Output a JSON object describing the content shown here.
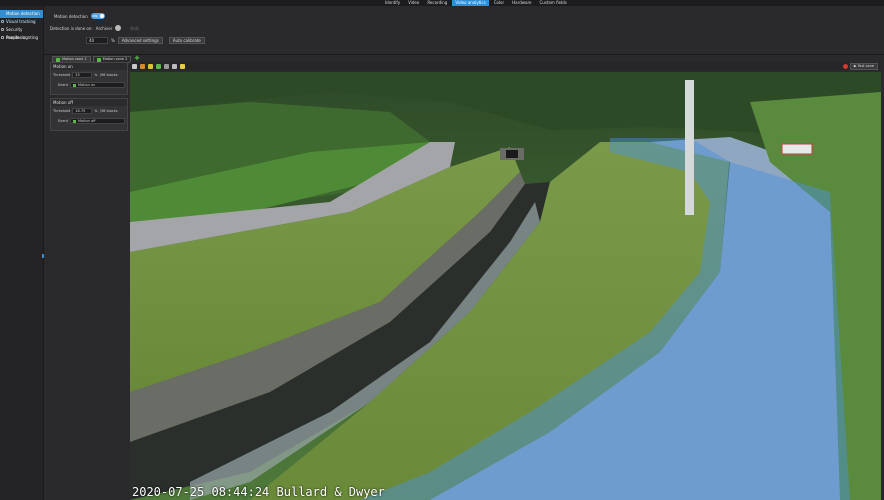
{
  "top_nav": {
    "items": [
      "Identify",
      "Video",
      "Recording",
      "Video analytics",
      "Color",
      "Hardware",
      "Custom fields"
    ],
    "active": "Video analytics"
  },
  "sidebar": {
    "items": [
      {
        "label": "Motion detection",
        "active": true
      },
      {
        "label": "Visual tracking",
        "active": false
      },
      {
        "label": "Security monitoring",
        "active": false
      },
      {
        "label": "People counting",
        "active": false
      }
    ]
  },
  "settings": {
    "motion_detection_label": "Motion detection",
    "motion_detection_toggle": "ON",
    "detection_done_on_label": "Detection is done on:",
    "detection_done_on_value": "Archiver",
    "detection_done_on_extra": "Unit",
    "sensitivity_value": "40",
    "sensitivity_unit": "%",
    "advanced_settings_label": "Advanced settings",
    "auto_calibrate_label": "Auto calibrate"
  },
  "zone_tabs": [
    {
      "label": "Motion zone 1",
      "active": true
    },
    {
      "label": "Motion zone 2",
      "active": false
    }
  ],
  "motion_on": {
    "title": "Motion on",
    "threshold_label": "Threshold",
    "threshold_value": "25",
    "threshold_pct": "%",
    "blocks": "(96 blocks",
    "event_label": "Event",
    "event_value": "Motion on"
  },
  "motion_off": {
    "title": "Motion off",
    "threshold_label": "Threshold",
    "threshold_value": "18.75",
    "threshold_pct": "%",
    "blocks": "(36 blocks",
    "event_label": "Event",
    "event_value": "Motion off"
  },
  "test_zone_label": "Test zone",
  "video": {
    "timestamp": "2020-07-25 08:44:24",
    "camera_name": "Bullard & Dwyer"
  },
  "colors": {
    "accent": "#2e8fd6",
    "zone_green": "#58b947",
    "mask_blue": "#4a90e2"
  }
}
